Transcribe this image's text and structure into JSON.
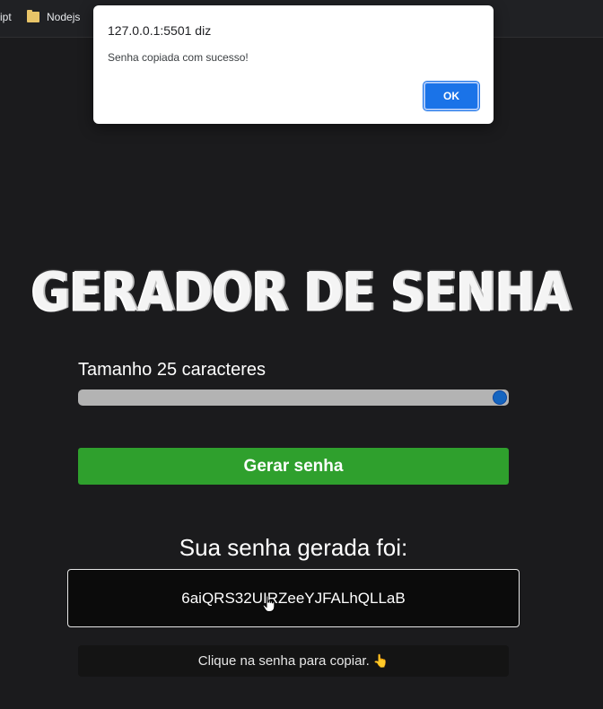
{
  "bookmarks": {
    "truncated_label": "ipt",
    "nodejs_label": "Nodejs",
    "folder_icon": "folder-icon"
  },
  "alert": {
    "origin": "127.0.0.1:5501 diz",
    "message": "Senha copiada com sucesso!",
    "ok_label": "OK"
  },
  "app": {
    "title": "GERADOR DE SENHA",
    "size_label": "Tamanho 25 caracteres",
    "slider": {
      "min": 6,
      "max": 25,
      "value": 25
    },
    "generate_label": "Gerar senha",
    "result_title": "Sua senha gerada foi:",
    "password": "6aiQRS32UIRZeeYJFALhQLLaB",
    "tooltip_text": "Clique na senha para copiar.",
    "tooltip_icon": "👆"
  },
  "colors": {
    "background": "#1b1b1d",
    "generate_button": "#2fa02d",
    "slider_thumb": "#1565c0",
    "dialog_ok": "#1a73e8"
  }
}
